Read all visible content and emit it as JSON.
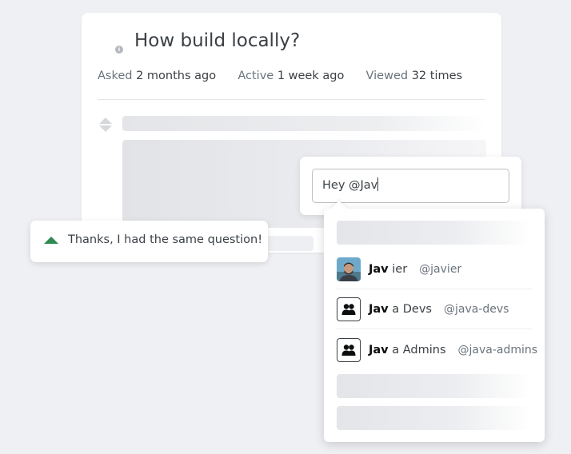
{
  "question": {
    "title": "How build locally?",
    "asked_label": "Asked",
    "asked_value": "2 months ago",
    "active_label": "Active",
    "active_value": "1 week ago",
    "viewed_label": "Viewed",
    "viewed_value": "32 times"
  },
  "comment": {
    "text": "Thanks, I had the same question!"
  },
  "message": {
    "value": "Hey @Jav"
  },
  "suggestions": [
    {
      "match": "Jav",
      "rest": "ier",
      "handle": "@javier",
      "icon": "user-avatar"
    },
    {
      "match": "Jav",
      "rest": "a Devs",
      "handle": "@java-devs",
      "icon": "group-icon"
    },
    {
      "match": "Jav",
      "rest": "a Admins",
      "handle": "@java-admins",
      "icon": "group-icon"
    }
  ],
  "colors": {
    "accent_upvote": "#2f8a52",
    "background": "#eff0f4"
  }
}
